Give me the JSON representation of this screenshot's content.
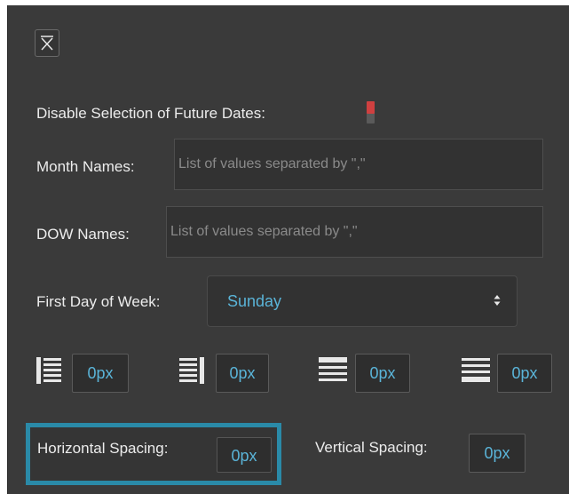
{
  "close": {
    "icon": "close-icon"
  },
  "future_dates": {
    "label": "Disable Selection of Future Dates:",
    "toggle_on": true,
    "toggle_color": "#cf4040"
  },
  "month_names": {
    "label": "Month Names:",
    "placeholder": "List of values separated by \",\""
  },
  "dow_names": {
    "label": "DOW Names:",
    "placeholder": "List of values separated by \",\""
  },
  "first_day": {
    "label": "First Day of Week:",
    "value": "Sunday"
  },
  "alignment": [
    {
      "icon": "align-left-lines-icon",
      "value": "0px"
    },
    {
      "icon": "align-right-lines-icon",
      "value": "0px"
    },
    {
      "icon": "align-top-lines-icon",
      "value": "0px"
    },
    {
      "icon": "align-bottom-lines-icon",
      "value": "0px"
    }
  ],
  "spacing": {
    "horizontal_label": "Horizontal Spacing:",
    "horizontal_value": "0px",
    "vertical_label": "Vertical Spacing:",
    "vertical_value": "0px"
  },
  "colors": {
    "panel_bg": "#3a3a3a",
    "accent": "#5ab4d8",
    "highlight_border": "#2a8aa8"
  }
}
